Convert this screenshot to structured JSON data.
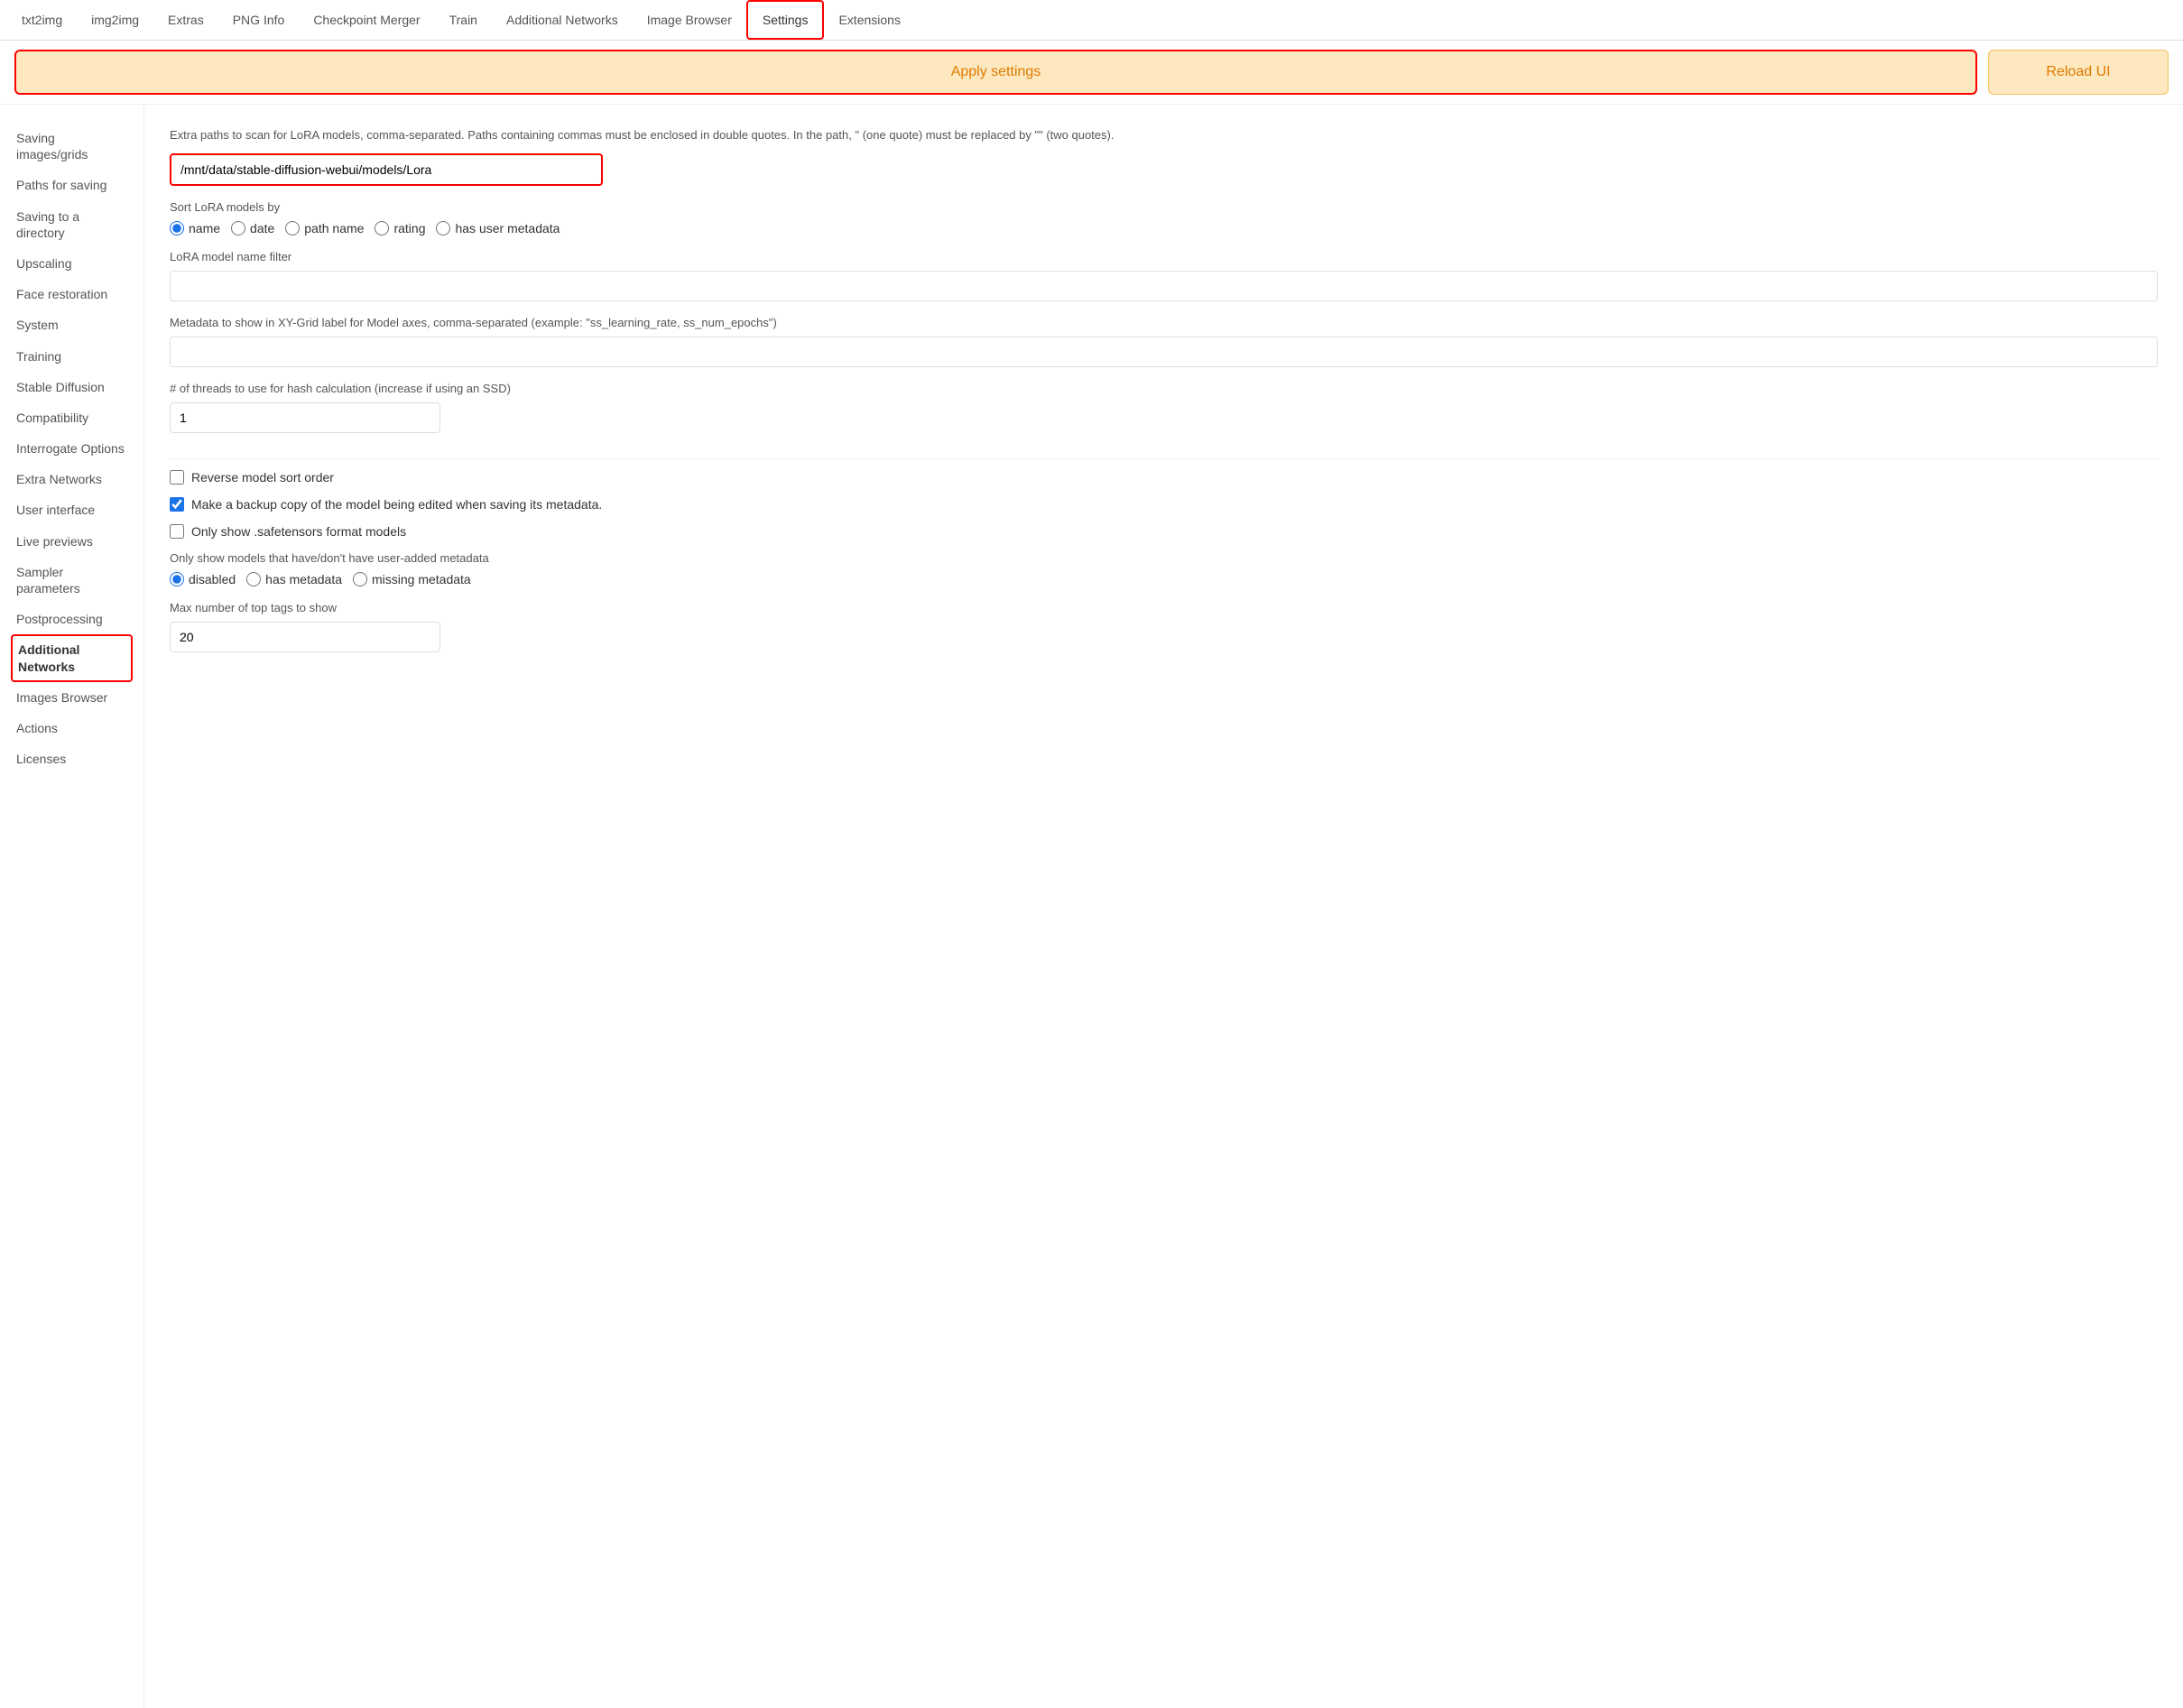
{
  "nav": {
    "items": [
      {
        "label": "txt2img",
        "active": false
      },
      {
        "label": "img2img",
        "active": false
      },
      {
        "label": "Extras",
        "active": false
      },
      {
        "label": "PNG Info",
        "active": false
      },
      {
        "label": "Checkpoint Merger",
        "active": false
      },
      {
        "label": "Train",
        "active": false
      },
      {
        "label": "Additional Networks",
        "active": false
      },
      {
        "label": "Image Browser",
        "active": false
      },
      {
        "label": "Settings",
        "active": true
      },
      {
        "label": "Extensions",
        "active": false
      }
    ]
  },
  "toolbar": {
    "apply_label": "Apply settings",
    "reload_label": "Reload UI"
  },
  "sidebar": {
    "items": [
      {
        "label": "Saving images/grids",
        "active": false
      },
      {
        "label": "Paths for saving",
        "active": false
      },
      {
        "label": "Saving to a directory",
        "active": false
      },
      {
        "label": "Upscaling",
        "active": false
      },
      {
        "label": "Face restoration",
        "active": false
      },
      {
        "label": "System",
        "active": false
      },
      {
        "label": "Training",
        "active": false
      },
      {
        "label": "Stable Diffusion",
        "active": false
      },
      {
        "label": "Compatibility",
        "active": false
      },
      {
        "label": "Interrogate Options",
        "active": false
      },
      {
        "label": "Extra Networks",
        "active": false
      },
      {
        "label": "User interface",
        "active": false
      },
      {
        "label": "Live previews",
        "active": false
      },
      {
        "label": "Sampler parameters",
        "active": false
      },
      {
        "label": "Postprocessing",
        "active": false
      },
      {
        "label": "Additional Networks",
        "active": true
      },
      {
        "label": "Images Browser",
        "active": false
      },
      {
        "label": "Actions",
        "active": false
      },
      {
        "label": "Licenses",
        "active": false
      }
    ]
  },
  "content": {
    "lora_paths_description": "Extra paths to scan for LoRA models, comma-separated. Paths containing commas must be enclosed in double quotes. In the path, \" (one quote) must be replaced by \"\" (two quotes).",
    "lora_path_value": "/mnt/data/stable-diffusion-webui/models/Lora",
    "sort_by_label": "Sort LoRA models by",
    "sort_options": [
      {
        "label": "name",
        "value": "name",
        "checked": true
      },
      {
        "label": "date",
        "value": "date",
        "checked": false
      },
      {
        "label": "path name",
        "value": "path_name",
        "checked": false
      },
      {
        "label": "rating",
        "value": "rating",
        "checked": false
      },
      {
        "label": "has user metadata",
        "value": "has_user_metadata",
        "checked": false
      }
    ],
    "name_filter_label": "LoRA model name filter",
    "name_filter_value": "",
    "metadata_label": "Metadata to show in XY-Grid label for Model axes, comma-separated (example: \"ss_learning_rate, ss_num_epochs\")",
    "metadata_value": "",
    "threads_label": "# of threads to use for hash calculation (increase if using an SSD)",
    "threads_value": "1",
    "reverse_sort_label": "Reverse model sort order",
    "reverse_sort_checked": false,
    "backup_copy_label": "Make a backup copy of the model being edited when saving its metadata.",
    "backup_copy_checked": true,
    "safetensors_label": "Only show .safetensors format models",
    "safetensors_checked": false,
    "metadata_filter_label": "Only show models that have/don't have user-added metadata",
    "metadata_filter_options": [
      {
        "label": "disabled",
        "value": "disabled",
        "checked": true
      },
      {
        "label": "has metadata",
        "value": "has_metadata",
        "checked": false
      },
      {
        "label": "missing metadata",
        "value": "missing_metadata",
        "checked": false
      }
    ],
    "top_tags_label": "Max number of top tags to show",
    "top_tags_value": "20"
  }
}
